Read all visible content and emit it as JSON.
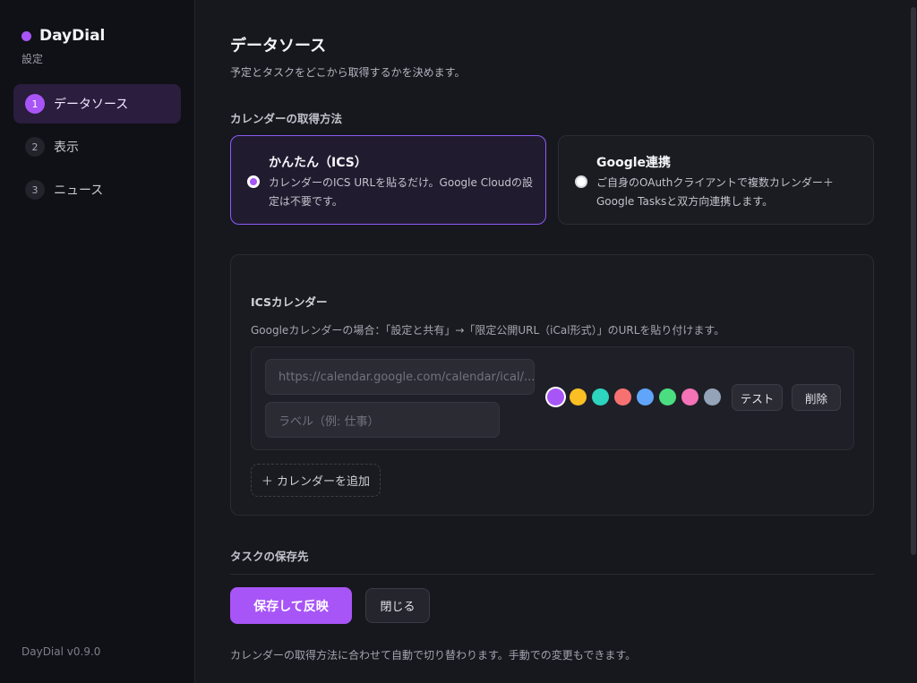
{
  "sidebar": {
    "brand": "DayDial",
    "subtitle": "設定",
    "items": [
      {
        "num": "1",
        "label": "データソース",
        "active": true
      },
      {
        "num": "2",
        "label": "表示"
      },
      {
        "num": "3",
        "label": "ニュース"
      }
    ],
    "version": "DayDial v0.9.0"
  },
  "main": {
    "title": "データソース",
    "description": "予定とタスクをどこから取得するかを決めます。",
    "calendar_method_label": "カレンダーの取得方法",
    "modes": [
      {
        "title": "かんたん（ICS）",
        "desc": "カレンダーのICS URLを貼るだけ。Google Cloudの設定は不要です。",
        "selected": true
      },
      {
        "title": "Google連携",
        "desc": "ご自身のOAuthクライアントで複数カレンダー＋Google Tasksと双方向連携します。",
        "selected": false
      }
    ],
    "ics": {
      "title": "ICSカレンダー",
      "hint": "Googleカレンダーの場合：「設定と共有」→「限定公開URL（iCal形式）」のURLを貼り付けます。",
      "url_placeholder": "https://calendar.google.com/calendar/ical/...",
      "label_placeholder": "ラベル（例: 仕事）",
      "colors": [
        "#a855f7",
        "#fbbf24",
        "#2dd4bf",
        "#f87171",
        "#60a5fa",
        "#4ade80",
        "#f472b6",
        "#94a3b8"
      ],
      "selected_color": "#a855f7",
      "test_label": "テスト",
      "delete_label": "削除",
      "add_label": "＋ カレンダーを追加"
    },
    "task_dest_label": "タスクの保存先",
    "save_label": "保存して反映",
    "close_label": "閉じる",
    "footer_note": "カレンダーの取得方法に合わせて自動で切り替わります。手動での変更もできます。"
  }
}
